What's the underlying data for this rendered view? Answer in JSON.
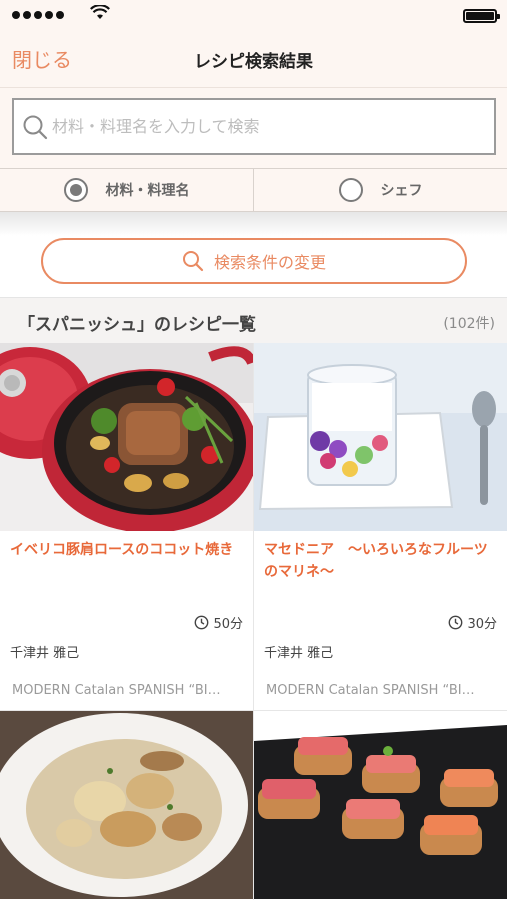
{
  "nav": {
    "close_label": "閉じる",
    "title": "レシピ検索結果"
  },
  "search": {
    "placeholder": "材料・料理名を入力して検索",
    "value": ""
  },
  "search_mode": {
    "options": [
      {
        "label": "材料・料理名",
        "selected": true
      },
      {
        "label": "シェフ",
        "selected": false
      }
    ]
  },
  "change_conditions": {
    "label": "検索条件の変更"
  },
  "results": {
    "title": "「スパニッシュ」のレシピ一覧",
    "count": "(102件)"
  },
  "recipes": [
    {
      "title": "イベリコ豚肩ロースのココット焼き",
      "time": "50分",
      "chef": "千津井 雅己",
      "source": "MODERN Catalan SPANISH “BI…"
    },
    {
      "title": "マセドニア　〜いろいろなフルーツのマリネ〜",
      "time": "30分",
      "chef": "千津井 雅己",
      "source": "MODERN Catalan SPANISH “BI…"
    },
    {
      "title": "",
      "time": "",
      "chef": "",
      "source": ""
    },
    {
      "title": "",
      "time": "",
      "chef": "",
      "source": ""
    }
  ],
  "colors": {
    "accent": "#e98a62",
    "title_accent": "#e8693a",
    "header_bg": "#fdf6f2"
  }
}
